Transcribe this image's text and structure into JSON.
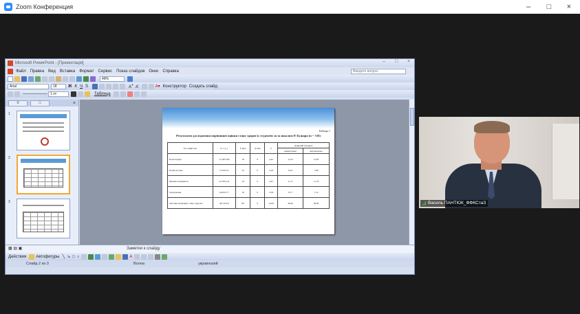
{
  "zoom": {
    "title": "Zoom Конференция",
    "minimize_glyph": "–",
    "maximize_glyph": "□",
    "close_glyph": "×"
  },
  "ppt": {
    "title": "Microsoft PowerPoint - [Презентація]",
    "menu": [
      "Файл",
      "Правка",
      "Вид",
      "Вставка",
      "Формат",
      "Сервис",
      "Показ слайдов",
      "Окно",
      "Справка"
    ],
    "help_placeholder": "Введите вопрос",
    "zoom": "49%",
    "font_name": "Arial",
    "font_size": "18",
    "designer_label": "Конструктор",
    "new_slide_label": "Создать слайд",
    "table_label": "Таблица",
    "line_width": "1 пт",
    "notes_placeholder": "Заметки к слайду",
    "draw_actions": "Действия",
    "autoshapes": "Автофигуры",
    "status": {
      "slide": "Слайд 2 из 3",
      "design": "Волна",
      "language": "украинский"
    }
  },
  "slide": {
    "table_no": "Таблиця 1",
    "heading": "Результати дослідження порівняної оцінки стану здоров'я студентів за за шкалою Р. Бушара (n = 116)",
    "columns": [
      "Тестовий тип",
      "X ± δ, у",
      "X max",
      "X min",
      "V",
      "V%",
      "Довірчий інтервал",
      "нижня межа",
      "верхня межа"
    ],
    "rows": [
      [
        "Конституція",
        "11,28±3,80",
        "18",
        "0",
        "4,42",
        "12,22",
        "12,85"
      ],
      [
        "Психологічна",
        "5,70±0,51",
        "10",
        "0",
        "4,18",
        "8,16",
        "7,86"
      ],
      [
        "Фізична активність",
        "12,79±4,31",
        "18",
        "0",
        "4,67",
        "11,11",
        "11,79"
      ],
      [
        "Харчування",
        "9,20±0,77",
        "18",
        "0",
        "5,58",
        "8,77",
        "7,12"
      ],
      [
        "Загальна величина стану здоров'я",
        "40,74±4,9",
        "80",
        "0",
        "12,64",
        "48,40",
        "58,90"
      ]
    ]
  },
  "participant": {
    "name": "Василь ПАНТЮК_ФФКСтаЗ"
  }
}
